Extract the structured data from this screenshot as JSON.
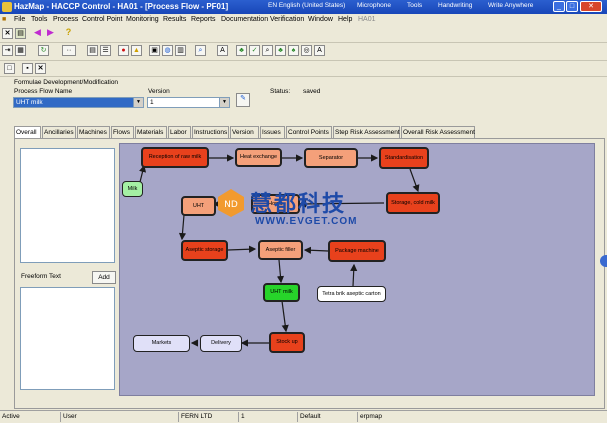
{
  "window": {
    "title": "HazMap - HACCP Control - HA01 - [Process Flow - PF01]",
    "lang_items": [
      "EN English (United States)",
      "Microphone",
      "Tools",
      "Handwriting",
      "Write Anywhere"
    ]
  },
  "menu": [
    "File",
    "Tools",
    "Process",
    "Control Point",
    "Monitoring",
    "Results",
    "Reports",
    "Documentation",
    "Verification",
    "Window",
    "Help",
    "HA01"
  ],
  "form": {
    "section_title": "Formulae Development/Modification",
    "process_flow_label": "Process Flow Name",
    "process_flow_value": "UHT milk",
    "version_label": "Version",
    "version_value": "1",
    "status_label": "Status:",
    "status_value": "saved"
  },
  "tabs": [
    "Overall",
    "Ancillaries",
    "Machines",
    "Flows",
    "Materials",
    "Labor",
    "Instructions",
    "Version",
    "Issues",
    "Control Points",
    "Step Risk Assessment",
    "Overall Risk Assessment"
  ],
  "active_tab": "Overall",
  "left_panel": {
    "freeform_label": "Freeform Text",
    "add_button": "Add"
  },
  "flow": {
    "nodes": {
      "milk": "Milk",
      "reception": "Reception of raw milk",
      "heat_exchange": "Heat exchange",
      "separator": "Separator",
      "standardisation": "Standardisation",
      "storage_cold": "Storage, cold milk",
      "uht": "UHT",
      "homo": "Homo",
      "aseptic_storage": "Aseptic storage",
      "aseptic_filler": "Aseptic filler",
      "package_machine": "Package machine",
      "uht_milk": "UHT milk",
      "tetra_brik": "Tetra brik aseptic carton",
      "stock_up": "Stock up",
      "delivery": "Delivery",
      "markets": "Markets"
    }
  },
  "watermark": {
    "brand": "慧都科技",
    "url": "WWW.EVGET.COM"
  },
  "statusbar": [
    "Active",
    "User",
    "FERN LTD",
    "1",
    "Default",
    "erpmap"
  ]
}
